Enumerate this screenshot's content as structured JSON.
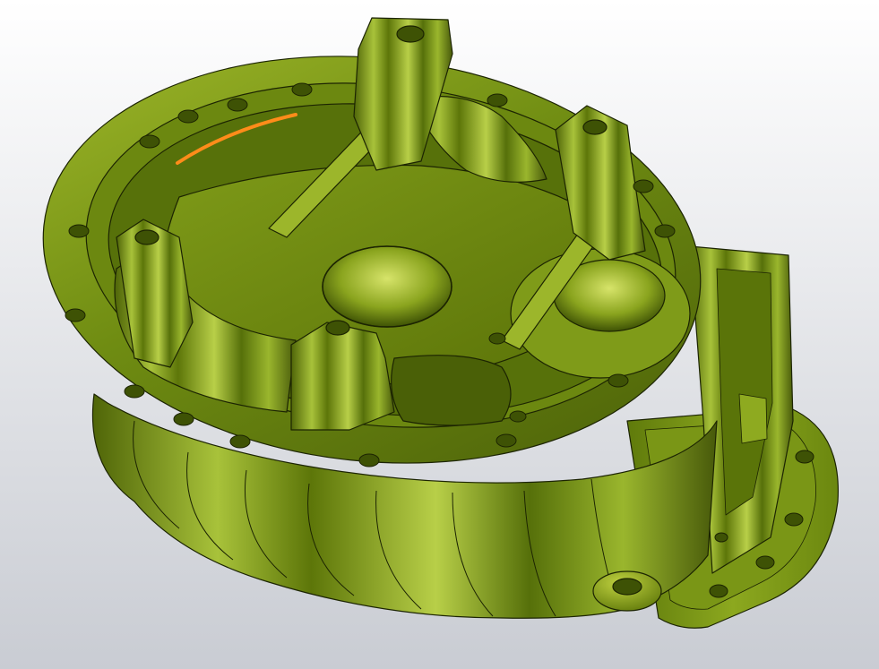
{
  "viewport": {
    "background_top": "#ffffff",
    "background_bottom": "#c9ccd3"
  },
  "model": {
    "part_color": "#6f8c12",
    "part_highlight": "#c4d44a",
    "part_shadow": "#3f5206",
    "edge_color": "#1c2402",
    "selected_edge_color": "#ff8c1a"
  }
}
